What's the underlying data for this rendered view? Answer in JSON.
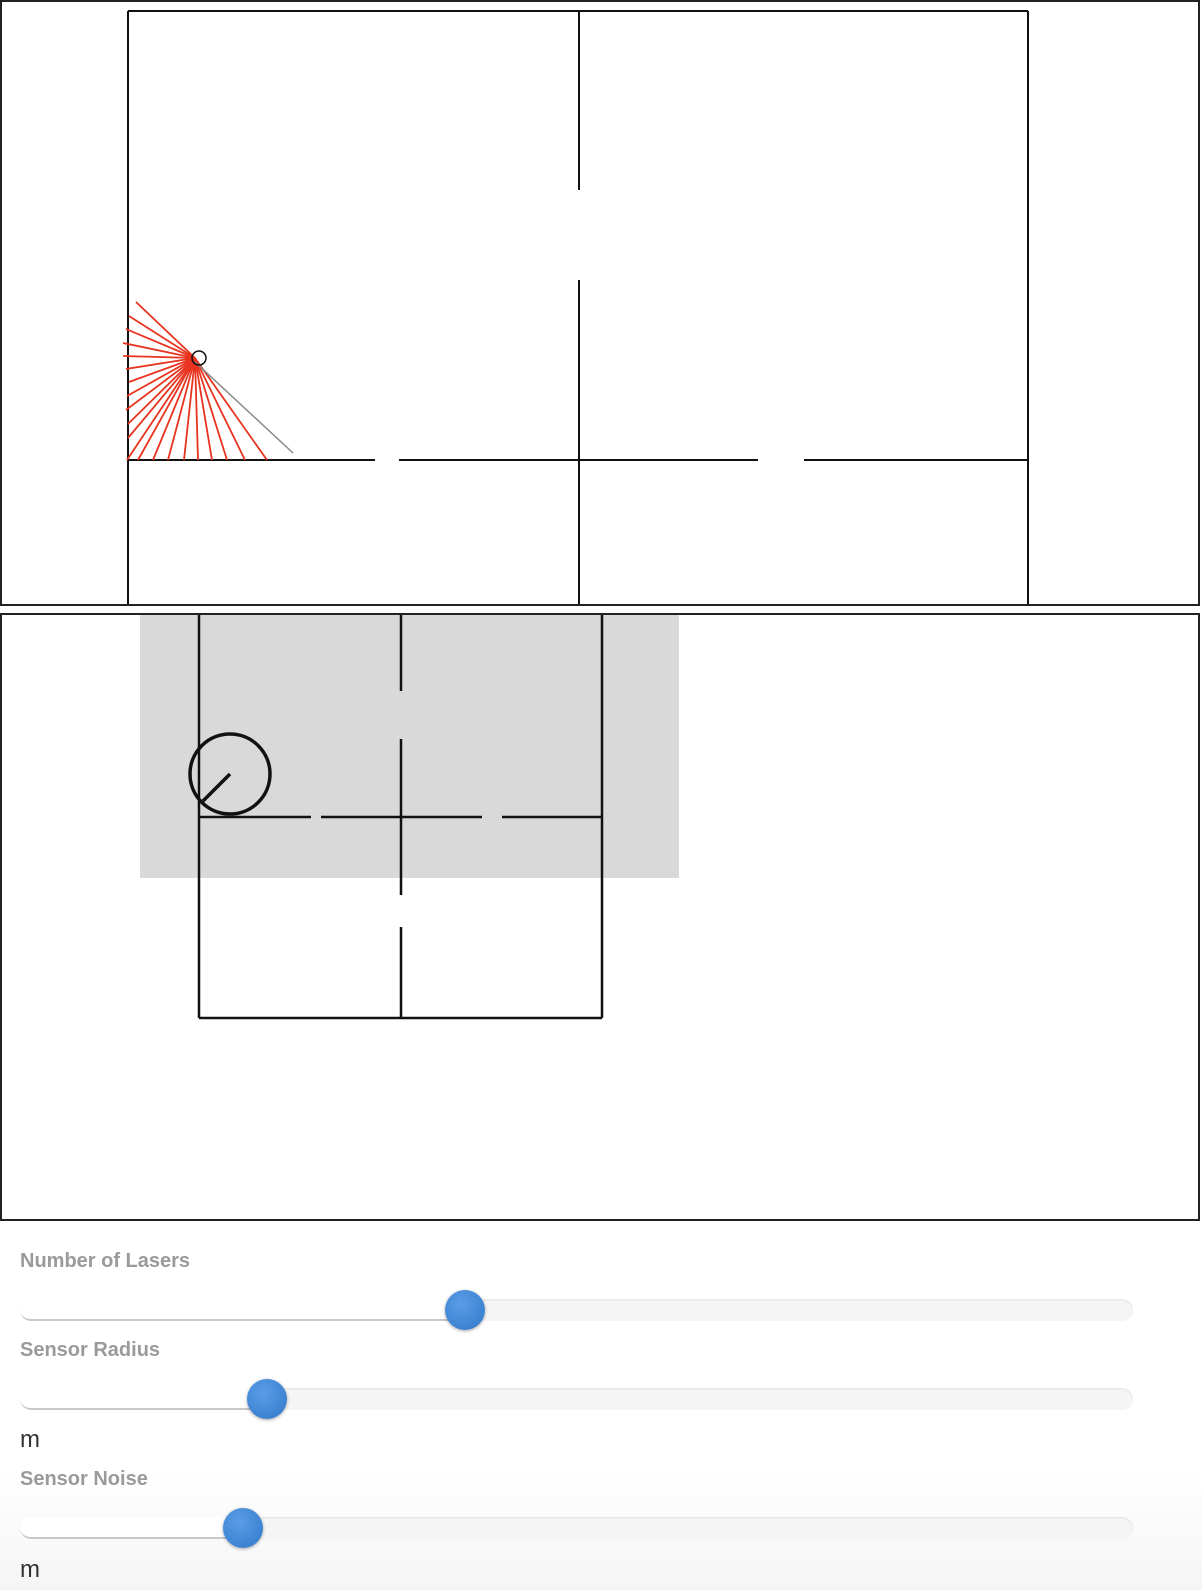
{
  "controls": {
    "lasers": {
      "label": "Number of Lasers",
      "value_fraction": 0.4
    },
    "radius": {
      "label": "Sensor Radius",
      "unit": "m",
      "value_fraction": 0.222
    },
    "noise": {
      "label": "Sensor Noise",
      "unit": "m",
      "value_fraction": 0.2
    }
  },
  "colors": {
    "laser": "#e8341f",
    "wall": "#111111",
    "map_explored": "#d9d9d9",
    "slider_handle": "#3a86d8"
  },
  "icons": {
    "robot": "robot-circle-icon",
    "robot_map": "robot-map-icon"
  }
}
